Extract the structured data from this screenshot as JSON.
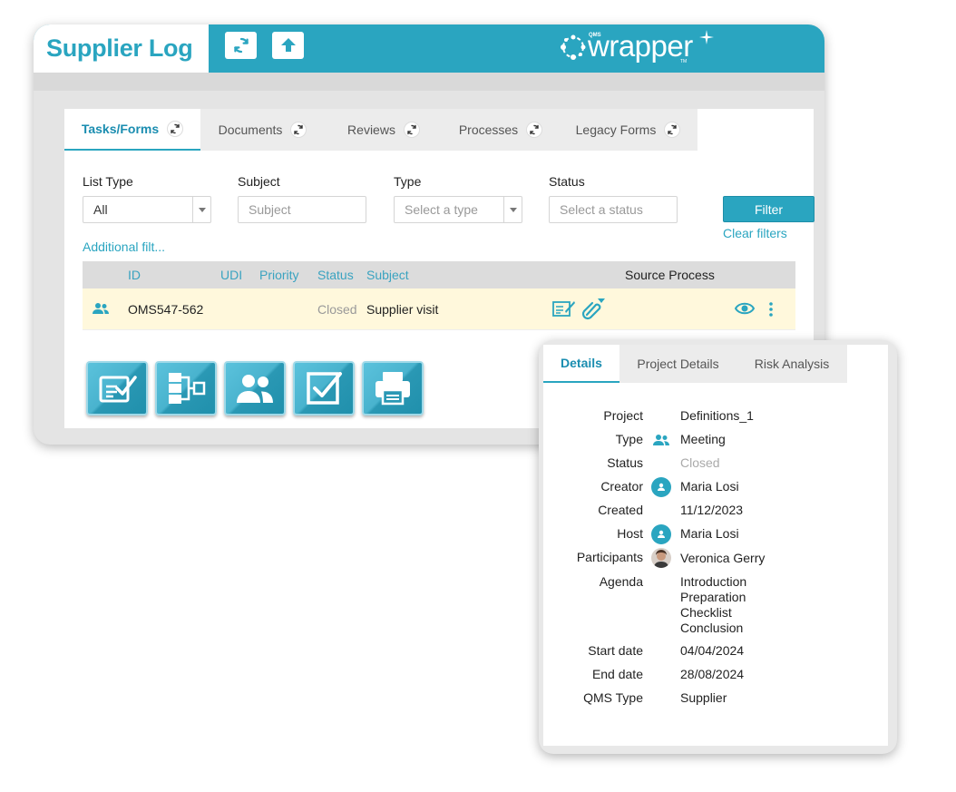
{
  "header": {
    "title": "Supplier Log",
    "logo_text": "wrapper",
    "logo_qms": "QMS",
    "logo_tm": "TM"
  },
  "tabs": [
    {
      "label": "Tasks/Forms",
      "active": true
    },
    {
      "label": "Documents",
      "active": false
    },
    {
      "label": "Reviews",
      "active": false
    },
    {
      "label": "Processes",
      "active": false
    },
    {
      "label": "Legacy Forms",
      "active": false
    }
  ],
  "filters": {
    "list_type_label": "List Type",
    "list_type_value": "All",
    "subject_label": "Subject",
    "subject_placeholder": "Subject",
    "type_label": "Type",
    "type_placeholder": "Select a type",
    "status_label": "Status",
    "status_placeholder": "Select a status",
    "filter_button": "Filter",
    "clear_link": "Clear filters",
    "additional_link": "Additional filt..."
  },
  "table": {
    "columns": [
      "ID",
      "UDI",
      "Priority",
      "Status",
      "Subject",
      "Source Process"
    ],
    "rows": [
      {
        "type_icon": "users-icon",
        "id": "OMS547-562",
        "udi": "",
        "priority": "",
        "status": "Closed",
        "subject": "Supplier visit"
      }
    ]
  },
  "toolbar_icons": [
    "form-check-icon",
    "flowchart-icon",
    "users-icon",
    "checkbox-icon",
    "printer-icon"
  ],
  "details": {
    "tabs": [
      {
        "label": "Details",
        "active": true
      },
      {
        "label": "Project Details",
        "active": false
      },
      {
        "label": "Risk Analysis",
        "active": false
      }
    ],
    "fields": {
      "project_label": "Project",
      "project": "Definitions_1",
      "type_label": "Type",
      "type": "Meeting",
      "status_label": "Status",
      "status": "Closed",
      "creator_label": "Creator",
      "creator": "Maria Losi",
      "created_label": "Created",
      "created": "11/12/2023",
      "host_label": "Host",
      "host": "Maria Losi",
      "participants_label": "Participants",
      "participants": "Veronica Gerry",
      "agenda_label": "Agenda",
      "agenda": [
        "Introduction",
        "Preparation",
        "Checklist",
        "Conclusion"
      ],
      "start_label": "Start date",
      "start": "04/04/2024",
      "end_label": "End date",
      "end": "28/08/2024",
      "qms_type_label": "QMS Type",
      "qms_type": "Supplier"
    }
  },
  "colors": {
    "accent": "#2aa5c0",
    "row_highlight": "#fff8dc",
    "link": "#2aa5c0"
  }
}
